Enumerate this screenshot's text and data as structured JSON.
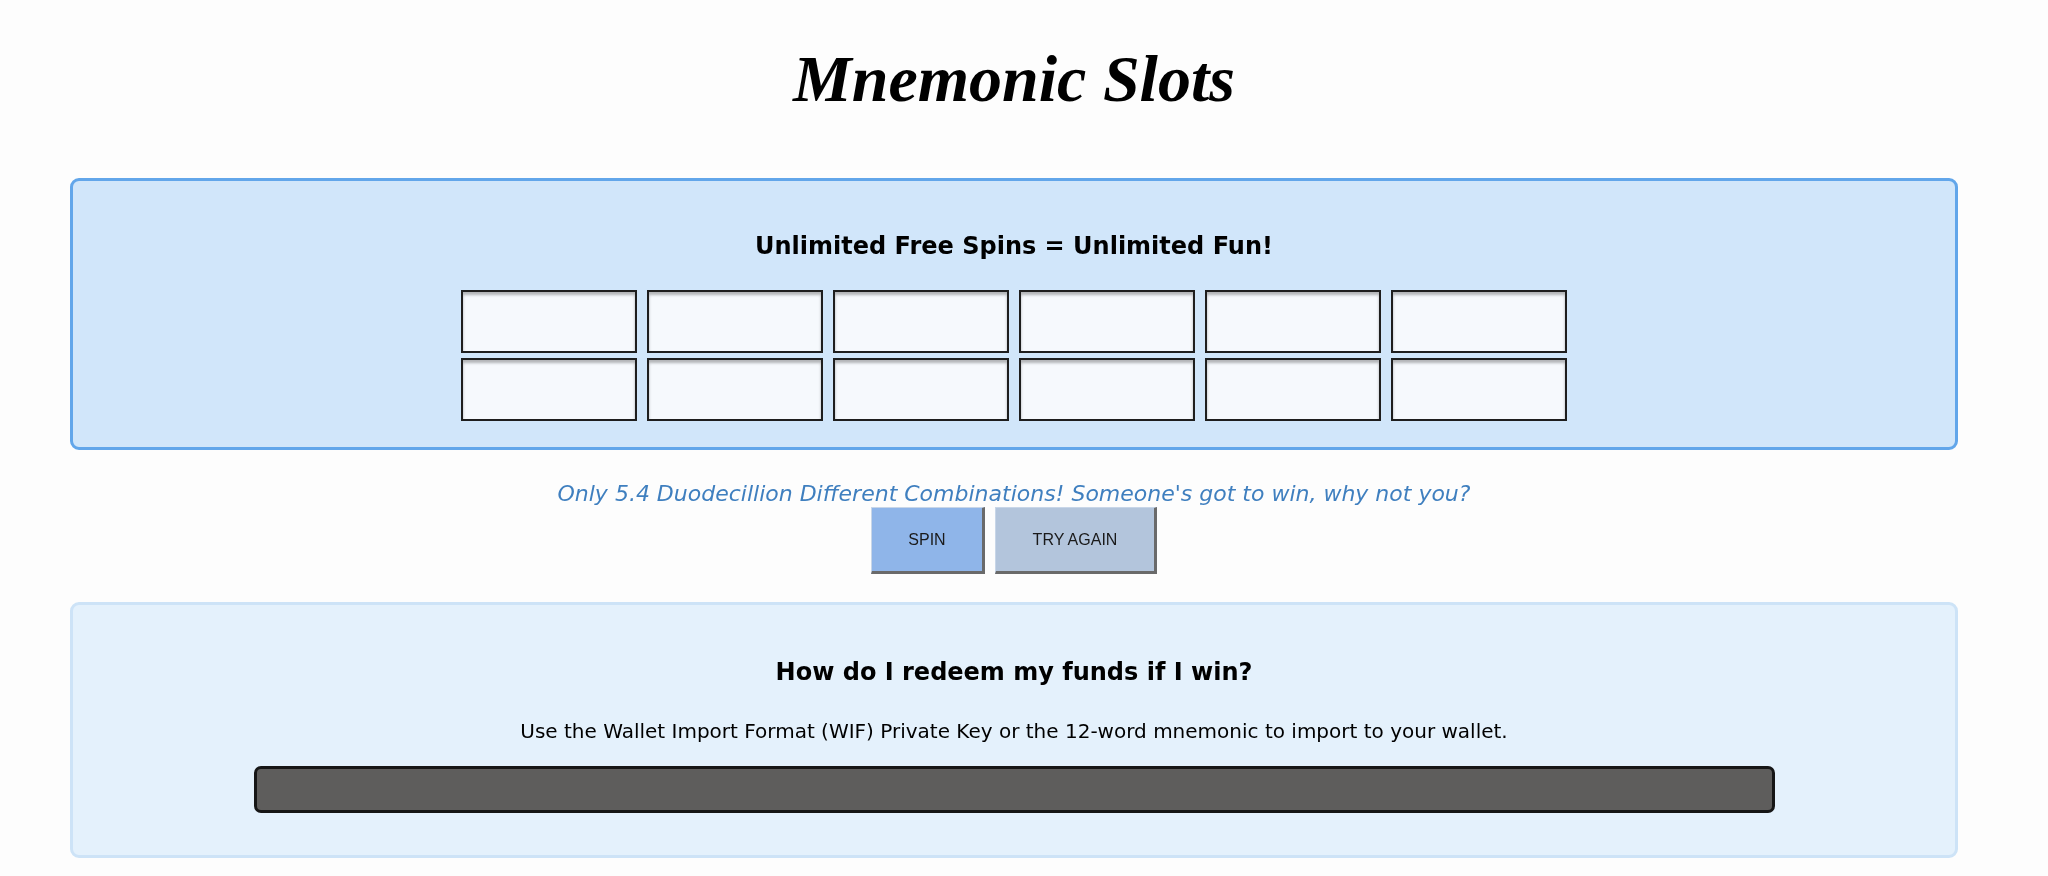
{
  "title": "Mnemonic Slots",
  "spin_panel": {
    "heading": "Unlimited Free Spins = Unlimited Fun!"
  },
  "tagline": "Only 5.4 Duodecillion Different Combinations! Someone's got to win, why not you?",
  "buttons": [
    {
      "label": "SPIN",
      "kind": "spin"
    },
    {
      "label": "TRY AGAIN",
      "kind": "retry"
    }
  ],
  "redeem_panel": {
    "heading": "How do I redeem my funds if I win?",
    "text": "Use the Wallet Import Format (WIF) Private Key or the 12-word mnemonic to import to your wallet."
  }
}
